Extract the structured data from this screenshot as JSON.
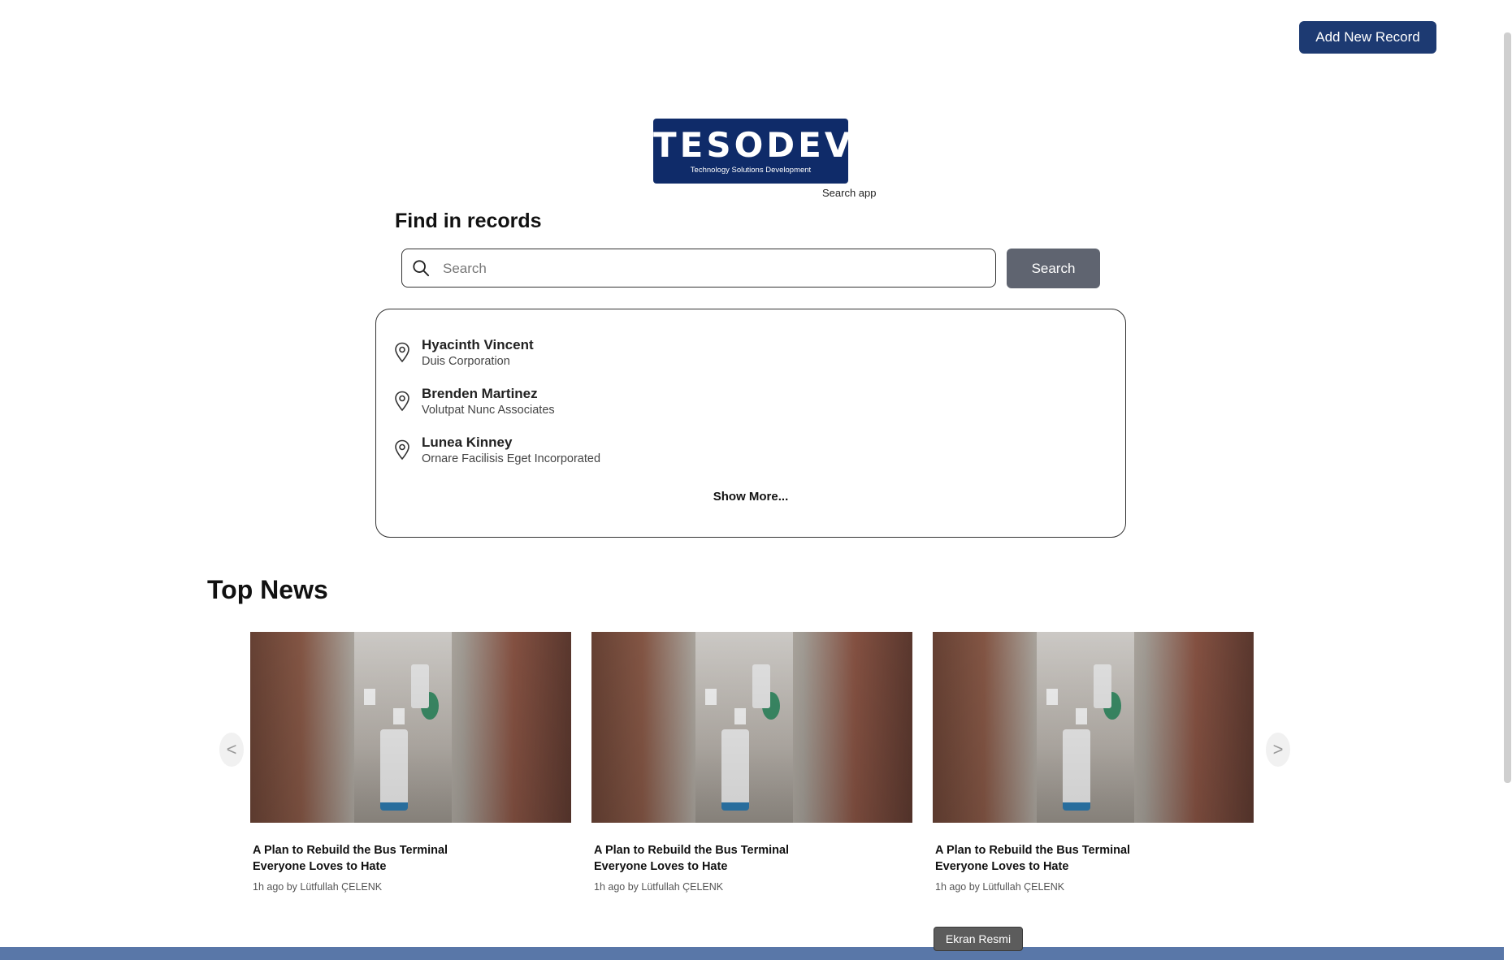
{
  "header": {
    "add_button_label": "Add New Record"
  },
  "logo": {
    "brand": "TESODEV",
    "tagline": "Technology Solutions Development",
    "caption": "Search app"
  },
  "search": {
    "title": "Find in records",
    "placeholder": "Search",
    "value": "",
    "button_label": "Search"
  },
  "results": {
    "items": [
      {
        "name": "Hyacinth Vincent",
        "company": "Duis Corporation"
      },
      {
        "name": "Brenden Martinez",
        "company": "Volutpat Nunc Associates"
      },
      {
        "name": "Lunea Kinney",
        "company": "Ornare Facilisis Eget Incorporated"
      }
    ],
    "show_more_label": "Show More..."
  },
  "news": {
    "title": "Top News",
    "prev_label": "<",
    "next_label": ">",
    "cards": [
      {
        "headline": "A Plan to Rebuild the Bus Terminal Everyone Loves to Hate",
        "meta": "1h ago by Lütfullah ÇELENK"
      },
      {
        "headline": "A Plan to Rebuild the Bus Terminal Everyone Loves to Hate",
        "meta": "1h ago by Lütfullah ÇELENK"
      },
      {
        "headline": "A Plan to Rebuild the Bus Terminal Everyone Loves to Hate",
        "meta": "1h ago by Lütfullah ÇELENK"
      }
    ]
  },
  "taskbar": {
    "tooltip": "Ekran Resmi"
  },
  "colors": {
    "primary": "#1d3a72",
    "search_button": "#5f6470",
    "logo_bg": "#0f2b69"
  }
}
